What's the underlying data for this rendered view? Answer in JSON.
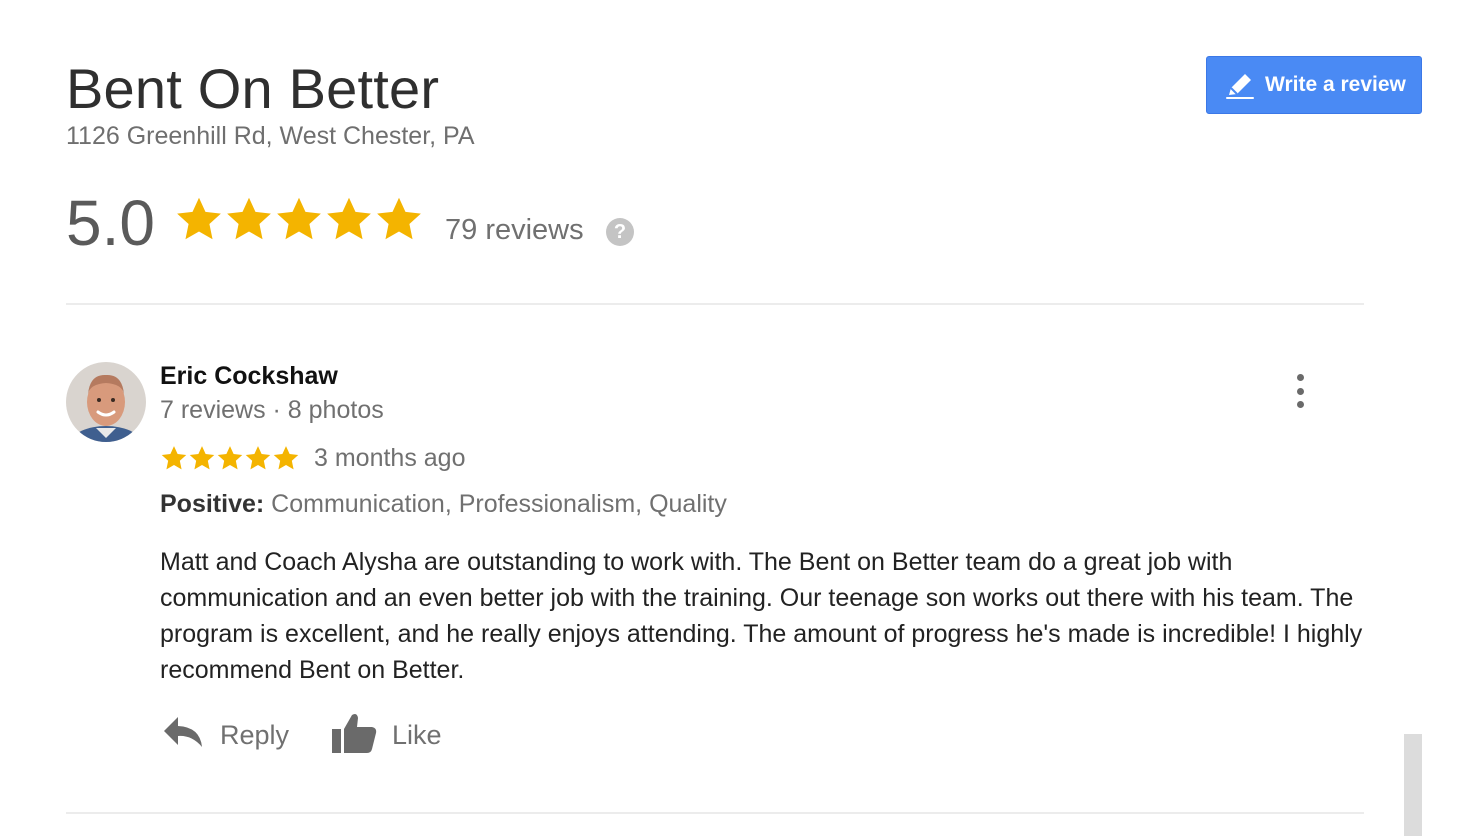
{
  "business": {
    "name": "Bent On Better",
    "address": "1126 Greenhill Rd, West Chester, PA"
  },
  "write_review_button": {
    "label": "Write a review",
    "icon": "pencil-icon"
  },
  "rating": {
    "value": "5.0",
    "stars": 5,
    "review_count_label": "79 reviews",
    "help_icon": "?"
  },
  "review": {
    "reviewer_name": "Eric Cockshaw",
    "reviewer_meta": "7 reviews · 8 photos",
    "stars": 5,
    "time": "3 months ago",
    "positive_label": "Positive:",
    "positive_values": "Communication, Professionalism, Quality",
    "text": "Matt and Coach Alysha are outstanding to work with. The Bent on Better team do a great job with communication and an even better job with the training. Our teenage son works out there with his team. The program is excellent, and he really enjoys attending. The amount of progress he's made is incredible! I highly recommend Bent on Better.",
    "actions": {
      "reply_label": "Reply",
      "like_label": "Like"
    }
  },
  "colors": {
    "star": "#f4b400",
    "button_blue": "#4a8af4",
    "text_gray": "#707070"
  }
}
